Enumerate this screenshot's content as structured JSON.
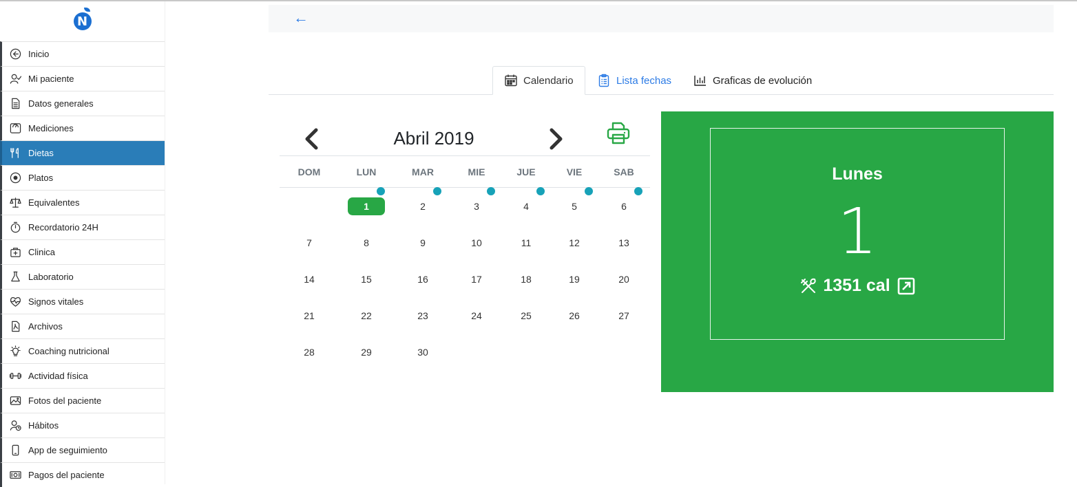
{
  "sidebar": {
    "items": [
      {
        "label": "Inicio",
        "icon": "back-circle-icon"
      },
      {
        "label": "Mi paciente",
        "icon": "user-check-icon"
      },
      {
        "label": "Datos generales",
        "icon": "document-icon"
      },
      {
        "label": "Mediciones",
        "icon": "scale-icon"
      },
      {
        "label": "Dietas",
        "icon": "utensils-icon",
        "active": true
      },
      {
        "label": "Platos",
        "icon": "plate-icon"
      },
      {
        "label": "Equivalentes",
        "icon": "balance-icon"
      },
      {
        "label": "Recordatorio 24H",
        "icon": "stopwatch-icon"
      },
      {
        "label": "Clinica",
        "icon": "medical-kit-icon"
      },
      {
        "label": "Laboratorio",
        "icon": "flask-icon"
      },
      {
        "label": "Signos vitales",
        "icon": "heart-pulse-icon"
      },
      {
        "label": "Archivos",
        "icon": "pdf-file-icon"
      },
      {
        "label": "Coaching nutricional",
        "icon": "lightbulb-icon"
      },
      {
        "label": "Actividad física",
        "icon": "dumbbell-icon"
      },
      {
        "label": "Fotos del paciente",
        "icon": "image-icon"
      },
      {
        "label": "Hábitos",
        "icon": "user-clock-icon"
      },
      {
        "label": "App de seguimiento",
        "icon": "mobile-icon"
      },
      {
        "label": "Pagos del paciente",
        "icon": "money-icon"
      }
    ]
  },
  "tabs": {
    "calendario": "Calendario",
    "lista_fechas": "Lista fechas",
    "graficas": "Graficas de evolución"
  },
  "calendar": {
    "month_title": "Abril 2019",
    "weekdays": [
      "DOM",
      "LUN",
      "MAR",
      "MIE",
      "JUE",
      "VIE",
      "SAB"
    ],
    "selected_day": 1,
    "days_with_diet": [
      1,
      2,
      3,
      4,
      5,
      6
    ],
    "weeks": [
      [
        "",
        "1",
        "2",
        "3",
        "4",
        "5",
        "6"
      ],
      [
        "7",
        "8",
        "9",
        "10",
        "11",
        "12",
        "13"
      ],
      [
        "14",
        "15",
        "16",
        "17",
        "18",
        "19",
        "20"
      ],
      [
        "21",
        "22",
        "23",
        "24",
        "25",
        "26",
        "27"
      ],
      [
        "28",
        "29",
        "30",
        "",
        "",
        "",
        ""
      ]
    ]
  },
  "panel": {
    "weekday": "Lunes",
    "day_number": "1",
    "calories": "1351 cal",
    "bg_color": "#28a745"
  },
  "colors": {
    "accent": "#2a7db8",
    "green": "#28a745",
    "dot": "#17a2b8",
    "link": "#2c7be5"
  }
}
